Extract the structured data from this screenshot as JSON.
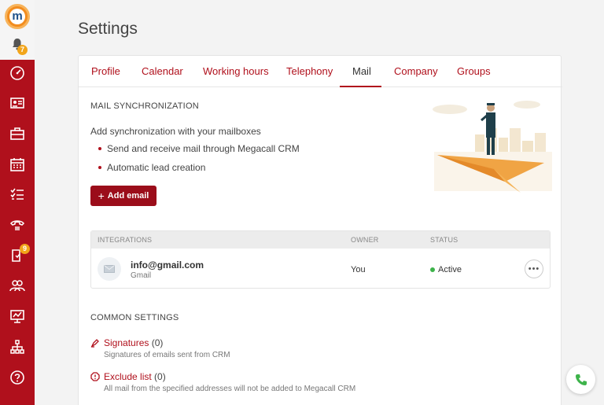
{
  "sidebar": {
    "notification_count": "7",
    "deals_badge": "9",
    "items": [
      {
        "name": "dashboard-icon"
      },
      {
        "name": "contacts-icon"
      },
      {
        "name": "briefcase-icon"
      },
      {
        "name": "calendar-icon"
      },
      {
        "name": "tasks-icon"
      },
      {
        "name": "telephony-icon"
      },
      {
        "name": "documents-icon"
      },
      {
        "name": "users-icon"
      },
      {
        "name": "analytics-icon"
      },
      {
        "name": "structure-icon"
      },
      {
        "name": "help-icon"
      }
    ]
  },
  "page": {
    "title": "Settings"
  },
  "tabs": {
    "profile": "Profile",
    "calendar": "Calendar",
    "working_hours": "Working hours",
    "telephony": "Telephony",
    "mail": "Mail",
    "company": "Company",
    "groups": "Groups",
    "active": "Mail"
  },
  "mail_sync": {
    "title": "MAIL SYNCHRONIZATION",
    "intro": "Add synchronization with your mailboxes",
    "bullets": [
      "Send and receive mail through Megacall CRM",
      "Automatic lead creation"
    ],
    "add_button": "Add email"
  },
  "integrations": {
    "columns": {
      "integrations": "INTEGRATIONS",
      "owner": "OWNER",
      "status": "STATUS"
    },
    "rows": [
      {
        "email": "info@gmail.com",
        "provider": "Gmail",
        "owner": "You",
        "status": "Active",
        "more": "•••"
      }
    ]
  },
  "common_settings": {
    "title": "COMMON SETTINGS",
    "signatures": {
      "label": "Signatures",
      "count": "(0)",
      "desc": "Signatures of emails sent from CRM"
    },
    "exclude_list": {
      "label": "Exclude list",
      "count": "(0)",
      "desc": "All mail from the specified addresses will not be added to Megacall CRM"
    }
  },
  "colors": {
    "accent": "#b0101c",
    "status_active": "#3db34a",
    "badge": "#f2a51a"
  }
}
